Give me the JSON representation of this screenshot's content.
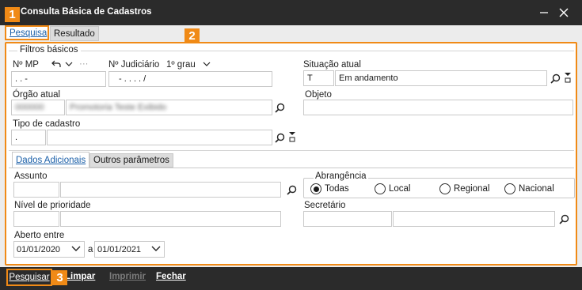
{
  "window": {
    "title": "Consulta Básica de Cadastros"
  },
  "badges": [
    "1",
    "2",
    "3"
  ],
  "tabs": {
    "search": "Pesquisa",
    "result": "Resultado"
  },
  "filtros": {
    "section_title": "Filtros básicos",
    "nmp_label": "Nº MP",
    "nmp_value": ". . -",
    "nmp_more": "···",
    "njud_label": "Nº Judiciário",
    "grau_label": "1º grau",
    "njud_value": "- . . . . /",
    "situacao_label": "Situação atual",
    "situacao_code": "T",
    "situacao_value": "Em andamento",
    "orgao_label": "Órgão atual",
    "orgao_code": "000000",
    "orgao_value": "Promotoria Teste Exibido",
    "objeto_label": "Objeto",
    "tipo_label": "Tipo de cadastro",
    "tipo_code": "."
  },
  "subtabs": {
    "dados": "Dados Adicionais",
    "outros": "Outros parâmetros"
  },
  "adicionais": {
    "assunto_label": "Assunto",
    "abrangencia_label": "Abrangência",
    "radios": [
      "Todas",
      "Local",
      "Regional",
      "Nacional"
    ],
    "prioridade_label": "Nível de prioridade",
    "secretario_label": "Secretário",
    "aberto_label": "Aberto entre",
    "date_from": "01/01/2020",
    "date_sep": "a",
    "date_to": "01/01/2021"
  },
  "buttons": {
    "pesquisar": "Pesquisar",
    "limpar": "Limpar",
    "imprimir": "Imprimir",
    "fechar": "Fechar"
  },
  "colors": {
    "accent": "#f08a16",
    "titlebar": "#2b2b2b",
    "link": "#1a5fa8"
  }
}
